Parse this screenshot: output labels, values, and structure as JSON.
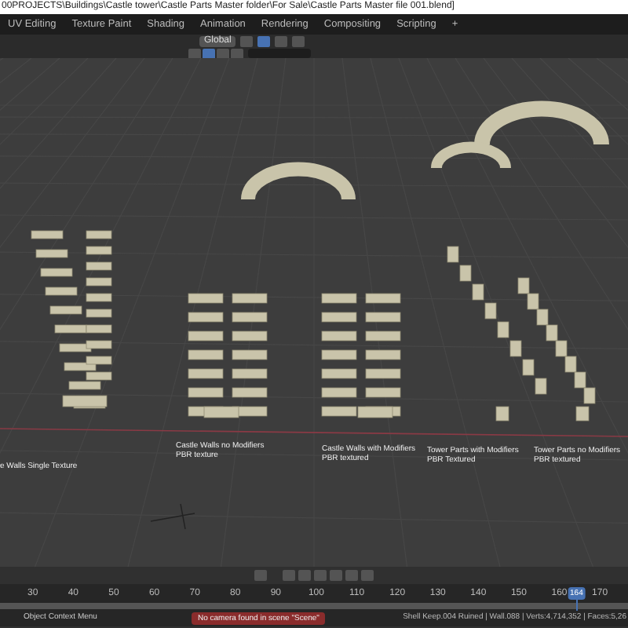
{
  "window": {
    "title": "00PROJECTS\\Buildings\\Castle tower\\Castle Parts Master folder\\For Sale\\Castle Parts Master file 001.blend]"
  },
  "workspace_tabs": [
    {
      "label": "UV Editing",
      "selected": false
    },
    {
      "label": "Texture Paint",
      "selected": false
    },
    {
      "label": "Shading",
      "selected": false
    },
    {
      "label": "Animation",
      "selected": false
    },
    {
      "label": "Rendering",
      "selected": false
    },
    {
      "label": "Compositing",
      "selected": false
    },
    {
      "label": "Scripting",
      "selected": false
    },
    {
      "label": "+",
      "selected": false
    }
  ],
  "header": {
    "orientation": "Global"
  },
  "viewport": {
    "labels": [
      {
        "lines": [
          "e Walls Single Texture"
        ]
      },
      {
        "lines": [
          "Castle Walls no Modifiers",
          "PBR texture"
        ]
      },
      {
        "lines": [
          "Castle Walls with Modifiers",
          "PBR textured"
        ]
      },
      {
        "lines": [
          "Tower Parts with Modifiers",
          "PBR Textured"
        ]
      },
      {
        "lines": [
          "Tower Parts no Modifiers",
          "PBR textured"
        ]
      }
    ]
  },
  "timeline": {
    "frames": [
      "30",
      "40",
      "50",
      "60",
      "70",
      "80",
      "90",
      "100",
      "110",
      "120",
      "130",
      "140",
      "150",
      "160",
      "170"
    ],
    "playhead": {
      "label": "164",
      "level": 0.918
    }
  },
  "status_bar": {
    "hint": "Object Context Menu",
    "warning": "No camera found in scene \"Scene\"",
    "stats": "Shell Keep.004 Ruined | Wall.088 | Verts:4,714,352 | Faces:5,26"
  }
}
